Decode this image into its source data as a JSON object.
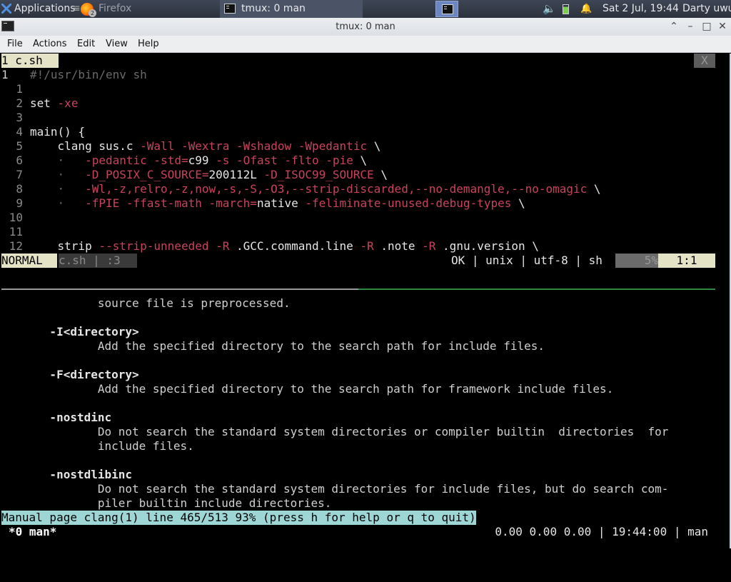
{
  "panel": {
    "applications_label": "Applications",
    "firefox_label": "Firefox",
    "firefox_badge": "2",
    "tmux_task_label": "tmux: 0 man",
    "datetime": "Sat  2 Jul, 19:44",
    "user": "Darty uwu",
    "volume_icon": "🔈",
    "battery_icon": "battery-icon",
    "bell_icon": "🔔"
  },
  "window": {
    "title": "tmux: 0 man",
    "btn_up": "⌃",
    "btn_min": "–",
    "btn_max": "□",
    "btn_close": "✕"
  },
  "menu": {
    "file": "File",
    "actions": "Actions",
    "edit": "Edit",
    "view": "View",
    "help": "Help"
  },
  "vim": {
    "tab_label": "1 c.sh",
    "tab_close": "X",
    "lines": [
      {
        "num": "1",
        "text": "#!/usr/bin/env sh"
      },
      {
        "num": "1",
        "text": ""
      },
      {
        "num": "2",
        "text": "set -xe"
      },
      {
        "num": "3",
        "text": ""
      },
      {
        "num": "4",
        "text": "main() {"
      },
      {
        "num": "5",
        "text": "    clang sus.c -Wall -Wextra -Wshadow -Wpedantic \\"
      },
      {
        "num": "6",
        "text": "    ·   -pedantic -std=c99 -s -Ofast -flto -pie \\"
      },
      {
        "num": "7",
        "text": "    ·   -D_POSIX_C_SOURCE=200112L -D_ISOC99_SOURCE \\"
      },
      {
        "num": "8",
        "text": "    ·   -Wl,-z,relro,-z,now,-s,-S,-O3,--strip-discarded,--no-demangle,--no-omagic \\"
      },
      {
        "num": "9",
        "text": "    ·   -fPIE -ffast-math -march=native -feliminate-unused-debug-types \\"
      },
      {
        "num": "10",
        "text": ""
      },
      {
        "num": "11",
        "text": ""
      },
      {
        "num": "12",
        "text": "    strip --strip-unneeded -R .GCC.command.line -R .note -R .gnu.version \\"
      }
    ],
    "status": {
      "mode": "NORMAL",
      "file": "c.sh | :3",
      "info": "OK | unix | utf-8 | sh",
      "percent": "5%",
      "position": "1:1"
    }
  },
  "man": {
    "lines": [
      "              source file is preprocessed.",
      "",
      "       -I<directory>",
      "              Add the specified directory to the search path for include files.",
      "",
      "       -F<directory>",
      "              Add the specified directory to the search path for framework include files.",
      "",
      "       -nostdinc",
      "              Do not search the standard system directories or compiler builtin  directories  for",
      "              include files.",
      "",
      "       -nostdlibinc",
      "              Do not search the standard system directories for include files, but do search com‐",
      "              piler builtin include directories."
    ],
    "status": "Manual page clang(1) line 465/513 93% (press h for help or q to quit)"
  },
  "tmux": {
    "window": "*0 man*",
    "right": "0.00 0.00 0.00 | 19:44:00 | man"
  }
}
